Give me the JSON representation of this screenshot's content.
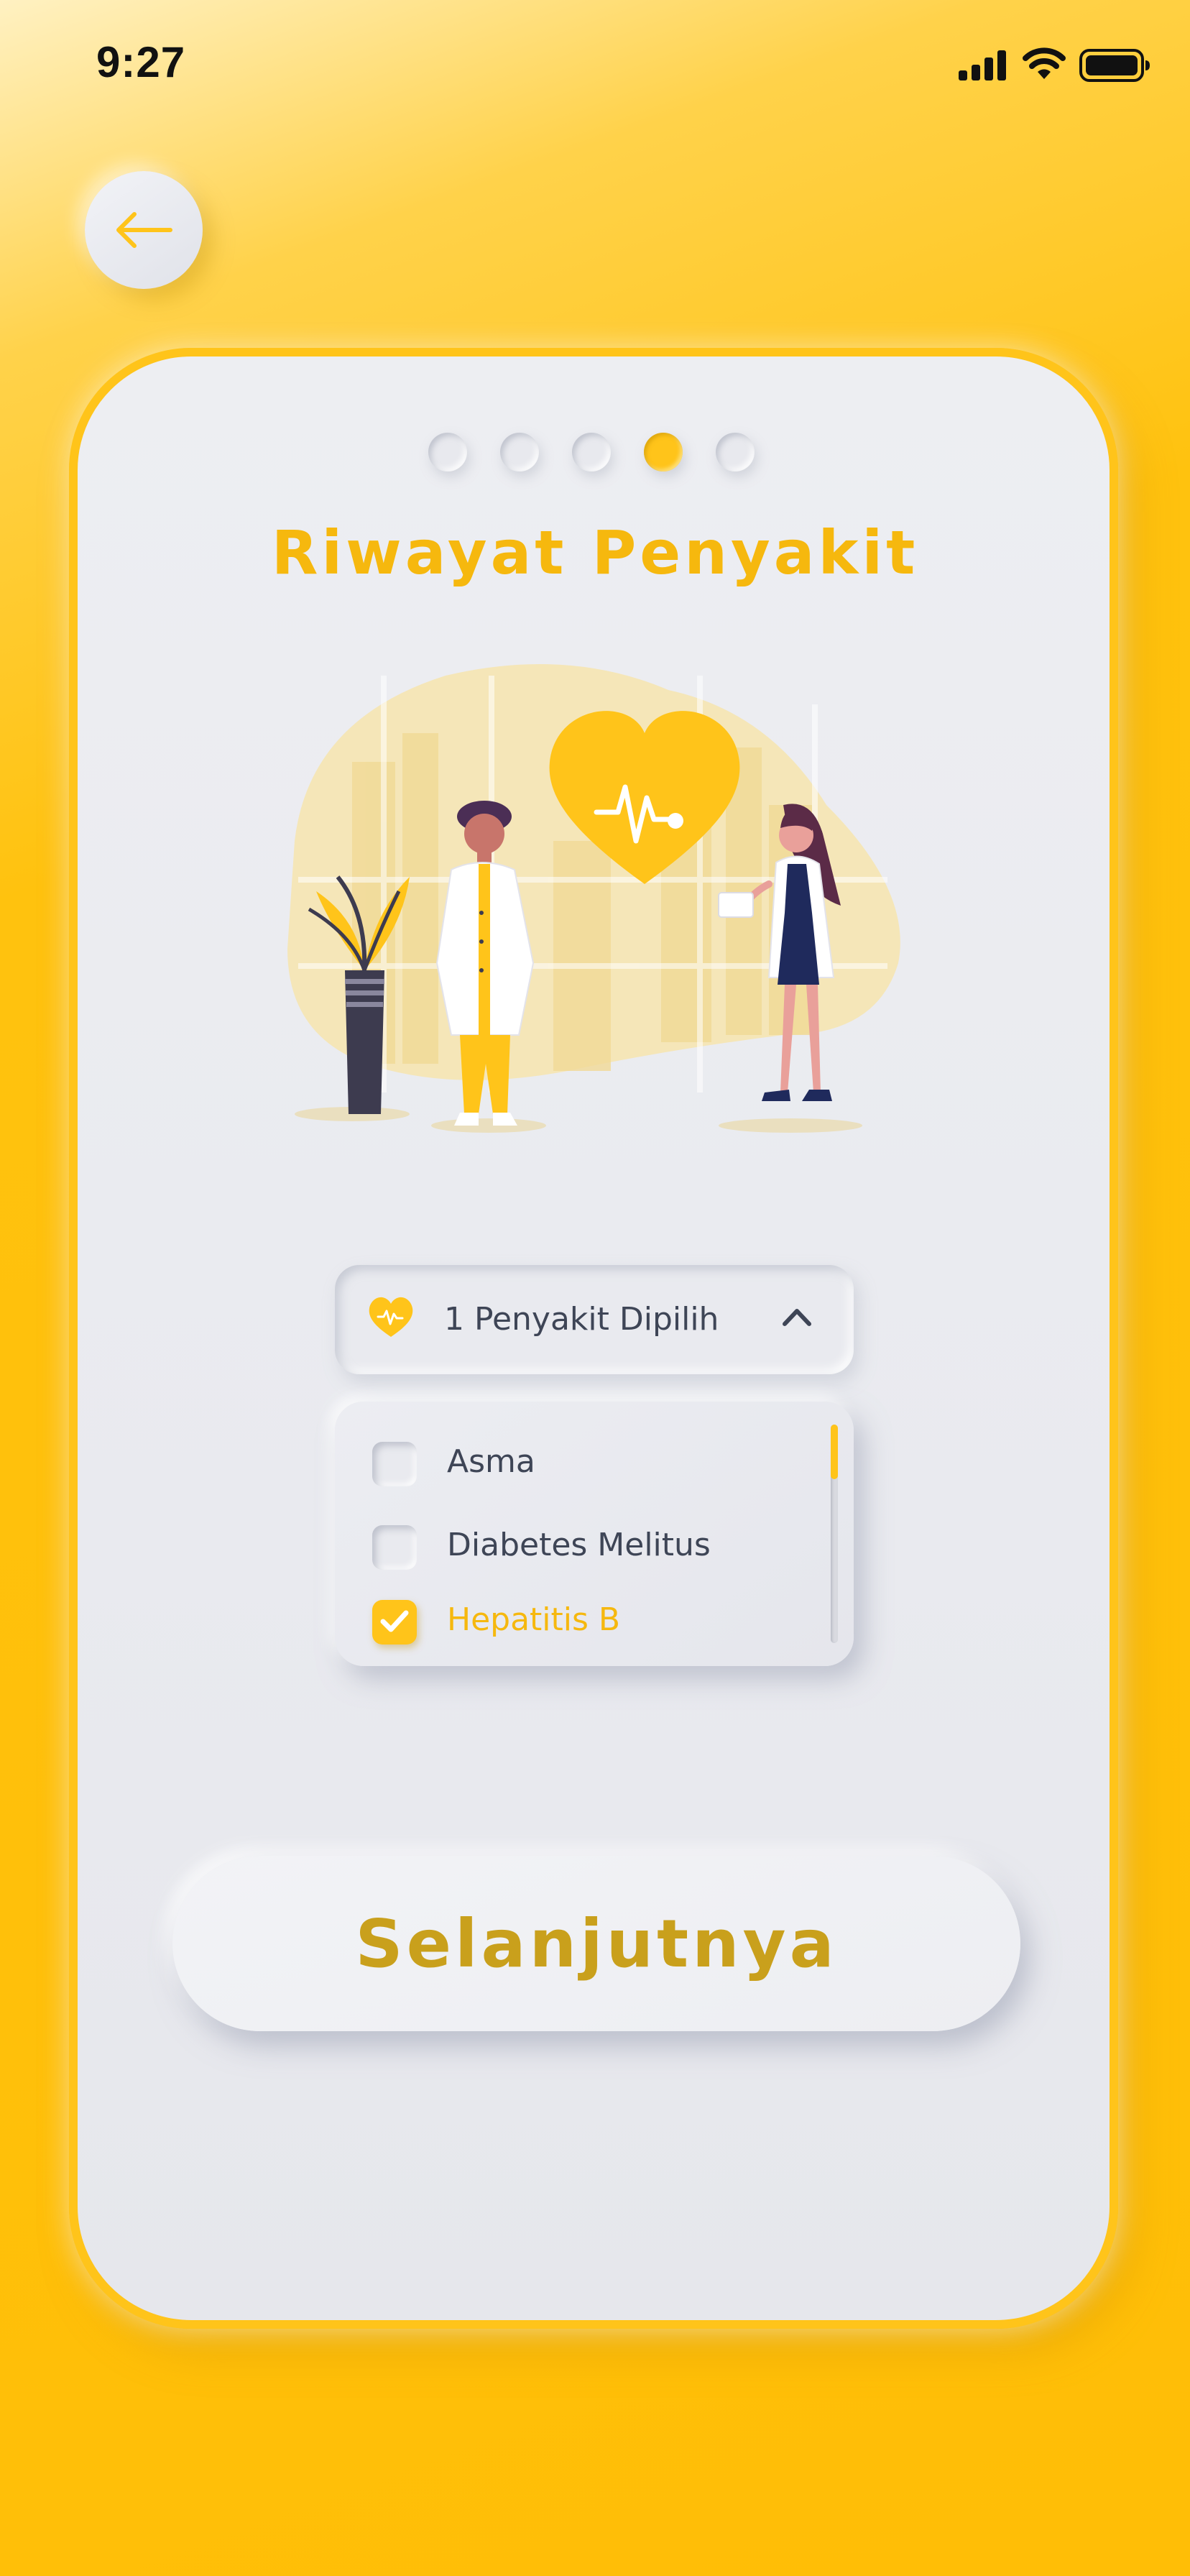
{
  "status_bar": {
    "time": "9:27"
  },
  "header": {
    "back_icon": "arrow-left-icon"
  },
  "stepper": {
    "total_steps": 5,
    "current_step": 4
  },
  "page": {
    "title": "Riwayat Penyakit"
  },
  "dropdown": {
    "icon": "heart-pulse-icon",
    "label": "1 Penyakit Dipilih",
    "expanded": true
  },
  "disease_list": {
    "items": [
      {
        "label": "Asma",
        "checked": false
      },
      {
        "label": "Diabetes Melitus",
        "checked": false
      },
      {
        "label": "Hepatitis B",
        "checked": true
      }
    ]
  },
  "footer": {
    "next_label": "Selanjutnya"
  },
  "colors": {
    "accent": "#FFC41A",
    "title": "#F6B80E",
    "button_text": "#C9A01C",
    "text": "#3E4556",
    "surface": "#E9EAEF"
  }
}
